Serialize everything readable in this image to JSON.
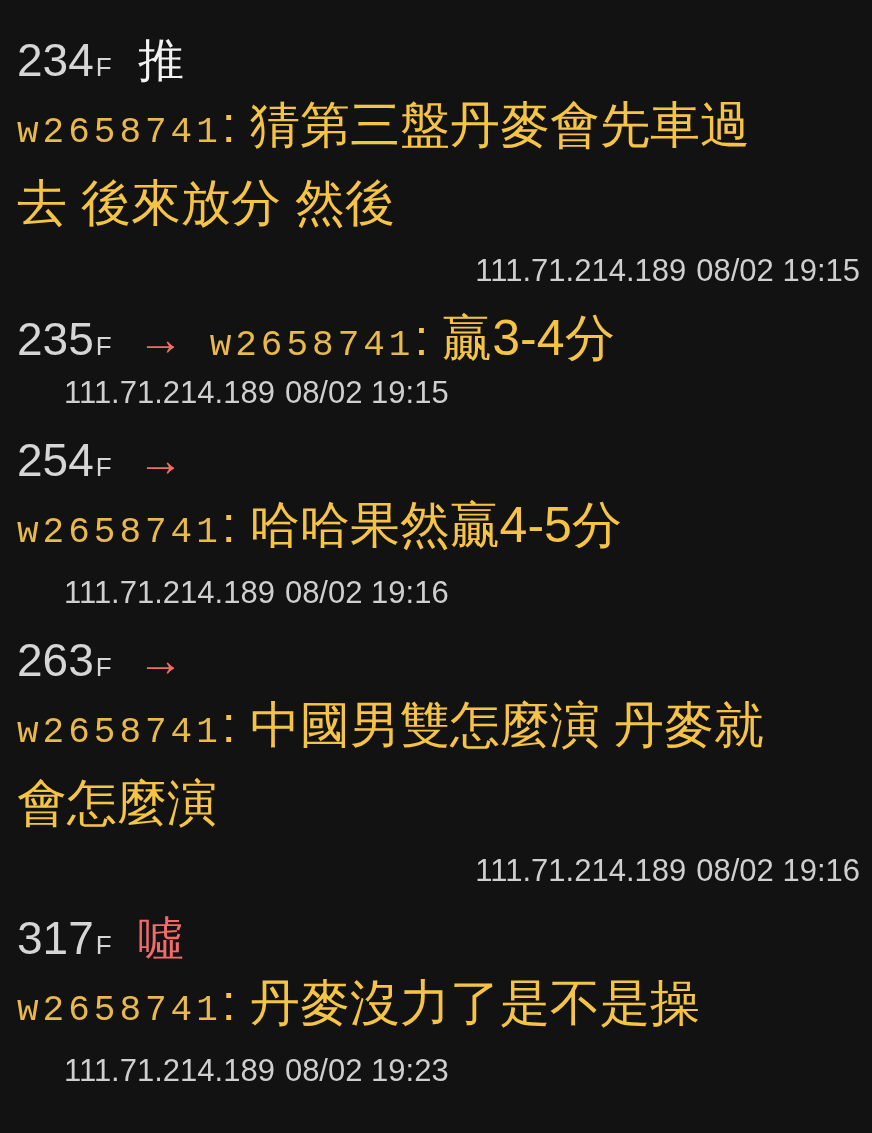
{
  "comments": [
    {
      "floor": "234",
      "floor_suffix": "F",
      "tag": "推",
      "color": "#f2f2f2",
      "kind": "long",
      "user": "w2658741",
      "content": ": 猜第三盤丹麥會先車過去 後來放分 然後",
      "ip": "111.71.214.189",
      "time": "08/02 19:15"
    },
    {
      "floor": "235",
      "floor_suffix": "F",
      "tag": "→",
      "color": "#f26b6b",
      "kind": "inline",
      "user": "w2658741",
      "content": ": 贏3-4分",
      "ip": "111.71.214.189",
      "time": "08/02 19:15"
    },
    {
      "floor": "254",
      "floor_suffix": "F",
      "tag": "→",
      "color": "#f26b6b",
      "kind": "short",
      "user": "w2658741",
      "content": ": 哈哈果然贏4-5分",
      "ip": "111.71.214.189",
      "time": "08/02 19:16"
    },
    {
      "floor": "263",
      "floor_suffix": "F",
      "tag": "→",
      "color": "#f26b6b",
      "kind": "long",
      "user": "w2658741",
      "content": ": 中國男雙怎麼演 丹麥就會怎麼演",
      "ip": "111.71.214.189",
      "time": "08/02 19:16"
    },
    {
      "floor": "317",
      "floor_suffix": "F",
      "tag": "噓",
      "color": "#f26b6b",
      "kind": "short",
      "user": "w2658741",
      "content": ": 丹麥沒力了是不是操",
      "ip": "111.71.214.189",
      "time": "08/02 19:23"
    }
  ]
}
